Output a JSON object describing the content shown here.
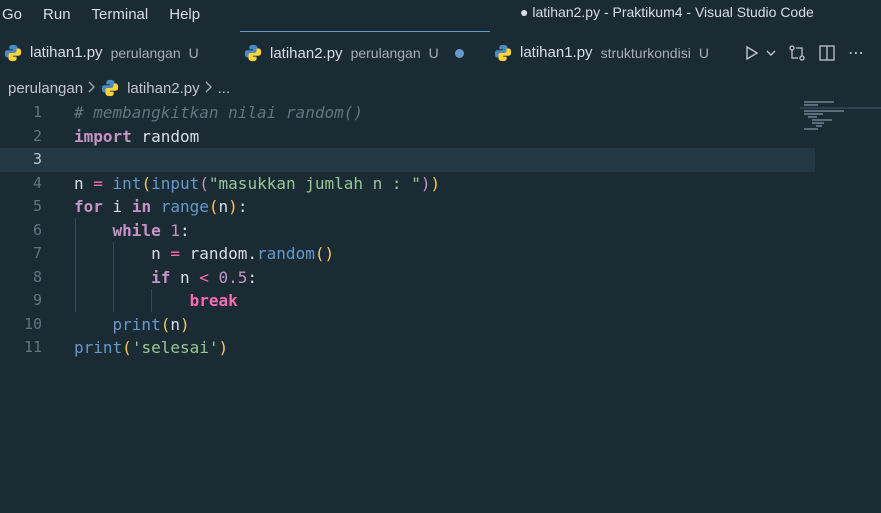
{
  "menu": {
    "items": [
      "Go",
      "Run",
      "Terminal",
      "Help"
    ],
    "window_title": "● latihan2.py - Praktikum4 - Visual Studio Code"
  },
  "tabs": [
    {
      "file": "latihan1.py",
      "dir": "perulangan",
      "status": "U"
    },
    {
      "file": "latihan2.py",
      "dir": "perulangan",
      "status": "U",
      "modified": true
    },
    {
      "file": "latihan1.py",
      "dir": "strukturkondisi",
      "status": "U"
    }
  ],
  "breadcrumb": {
    "folder": "perulangan",
    "file": "latihan2.py",
    "more": "..."
  },
  "editor": {
    "current_line": 3,
    "lines": [
      {
        "n": "1",
        "text": "# membangkitkan nilai random()"
      },
      {
        "n": "2",
        "text": "import random"
      },
      {
        "n": "3",
        "text": ""
      },
      {
        "n": "4",
        "text": "n = int(input(\"masukkan jumlah n : \"))"
      },
      {
        "n": "5",
        "text": "for i in range(n):"
      },
      {
        "n": "6",
        "text": "    while 1:"
      },
      {
        "n": "7",
        "text": "        n = random.random()"
      },
      {
        "n": "8",
        "text": "        if n < 0.5:"
      },
      {
        "n": "9",
        "text": "            break"
      },
      {
        "n": "10",
        "text": "    print(n)"
      },
      {
        "n": "11",
        "text": "print('selesai')"
      }
    ]
  },
  "colors": {
    "background": "#1b2b34",
    "current_line": "#223844",
    "keyword": "#c594c5",
    "function": "#6699cc",
    "string": "#99c794",
    "comment": "#65737e",
    "modified_dot": "#6699cc"
  }
}
